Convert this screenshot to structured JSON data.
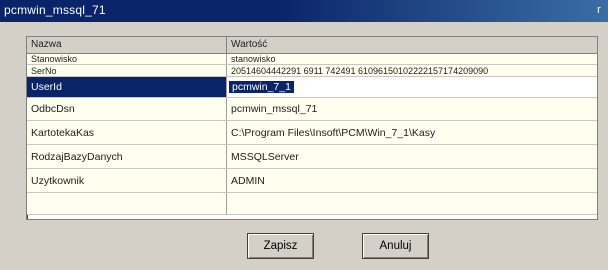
{
  "window": {
    "title": "pcmwin_mssql_71",
    "title_button": "r"
  },
  "grid": {
    "headers": {
      "name": "Nazwa",
      "value": "Wartość"
    },
    "rows": [
      {
        "name": "Stanowisko",
        "value": "stanowisko"
      },
      {
        "name": "SerNo",
        "value": "20514604442291 6911 742491 61096150102222157174209090"
      },
      {
        "name": "UserId",
        "value": "pcmwin_7_1"
      },
      {
        "name": "OdbcDsn",
        "value": "pcmwin_mssql_71"
      },
      {
        "name": "KartotekaKas",
        "value": "C:\\Program Files\\Insoft\\PCM\\Win_7_1\\Kasy"
      },
      {
        "name": "RodzajBazyDanych",
        "value": "MSSQLServer"
      },
      {
        "name": "Uzytkownik",
        "value": "ADMIN"
      }
    ],
    "selected_row": "UserId"
  },
  "buttons": {
    "save_label": "Zapisz",
    "cancel_label": "Anuluj"
  },
  "colors": {
    "titlebar": "#0a246a",
    "selection": "#0a246a",
    "grid_bg": "#fffff0",
    "dialog_bg": "#d4d0c8"
  }
}
